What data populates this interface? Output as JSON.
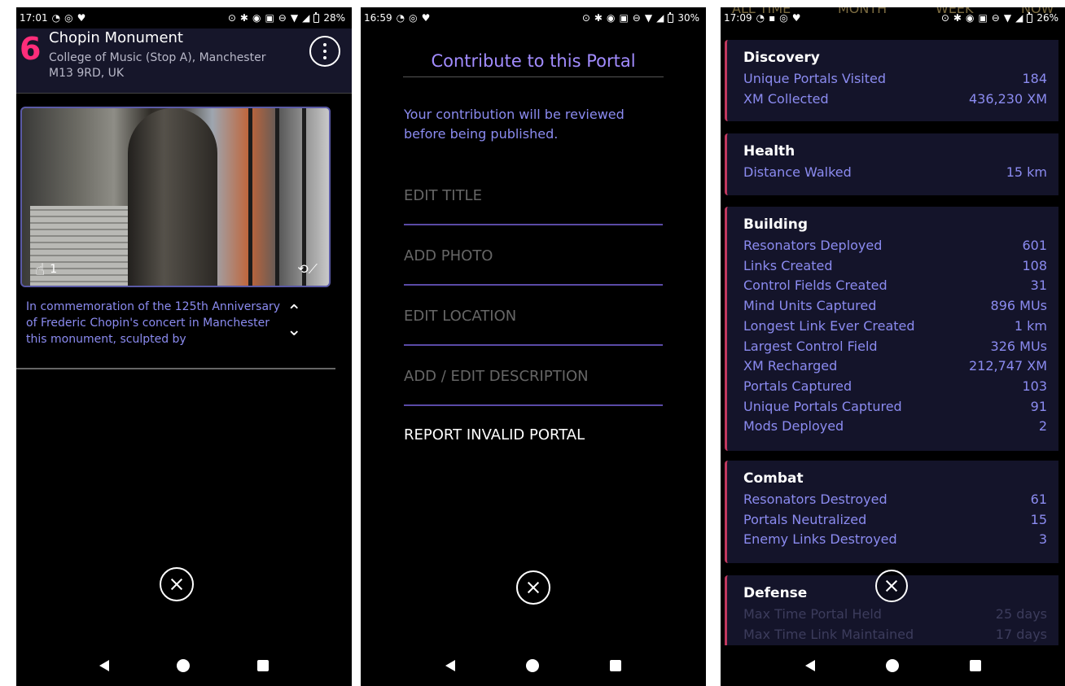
{
  "panel1": {
    "status": {
      "time": "17:01",
      "battery": "28%"
    },
    "portal": {
      "level": "6",
      "title": "Chopin Monument",
      "address": "College of Music (Stop A), Manchester M13 9RD, UK",
      "likes": "1",
      "description": "In commemoration of the 125th Anniversary of Frederic Chopin's concert in Manchester this monument, sculpted by"
    }
  },
  "panel2": {
    "status": {
      "time": "16:59",
      "battery": "30%"
    },
    "title": "Contribute to this Portal",
    "note": "Your contribution will be reviewed before being published.",
    "options": [
      "EDIT TITLE",
      "ADD PHOTO",
      "EDIT LOCATION",
      "ADD / EDIT DESCRIPTION"
    ],
    "report": "REPORT INVALID PORTAL"
  },
  "panel3": {
    "status": {
      "time": "17:09",
      "battery": "26%"
    },
    "ghost_tabs": [
      "ALL TIME",
      "MONTH",
      "WEEK",
      "NOW"
    ],
    "sections": [
      {
        "title": "Discovery",
        "rows": [
          {
            "label": "Unique Portals Visited",
            "value": "184"
          },
          {
            "label": "XM Collected",
            "value": "436,230 XM"
          }
        ]
      },
      {
        "title": "Health",
        "rows": [
          {
            "label": "Distance Walked",
            "value": "15 km"
          }
        ]
      },
      {
        "title": "Building",
        "rows": [
          {
            "label": "Resonators Deployed",
            "value": "601"
          },
          {
            "label": "Links Created",
            "value": "108"
          },
          {
            "label": "Control Fields Created",
            "value": "31"
          },
          {
            "label": "Mind Units Captured",
            "value": "896 MUs"
          },
          {
            "label": "Longest Link Ever Created",
            "value": "1 km"
          },
          {
            "label": "Largest Control Field",
            "value": "326 MUs"
          },
          {
            "label": "XM Recharged",
            "value": "212,747 XM"
          },
          {
            "label": "Portals Captured",
            "value": "103"
          },
          {
            "label": "Unique Portals Captured",
            "value": "91"
          },
          {
            "label": "Mods Deployed",
            "value": "2"
          }
        ]
      },
      {
        "title": "Combat",
        "rows": [
          {
            "label": "Resonators Destroyed",
            "value": "61"
          },
          {
            "label": "Portals Neutralized",
            "value": "15"
          },
          {
            "label": "Enemy Links Destroyed",
            "value": "3"
          }
        ]
      },
      {
        "title": "Defense",
        "rows": [
          {
            "label": "Max Time Portal Held",
            "value": "25 days"
          },
          {
            "label": "Max Time Link Maintained",
            "value": "17 days"
          }
        ]
      }
    ]
  }
}
